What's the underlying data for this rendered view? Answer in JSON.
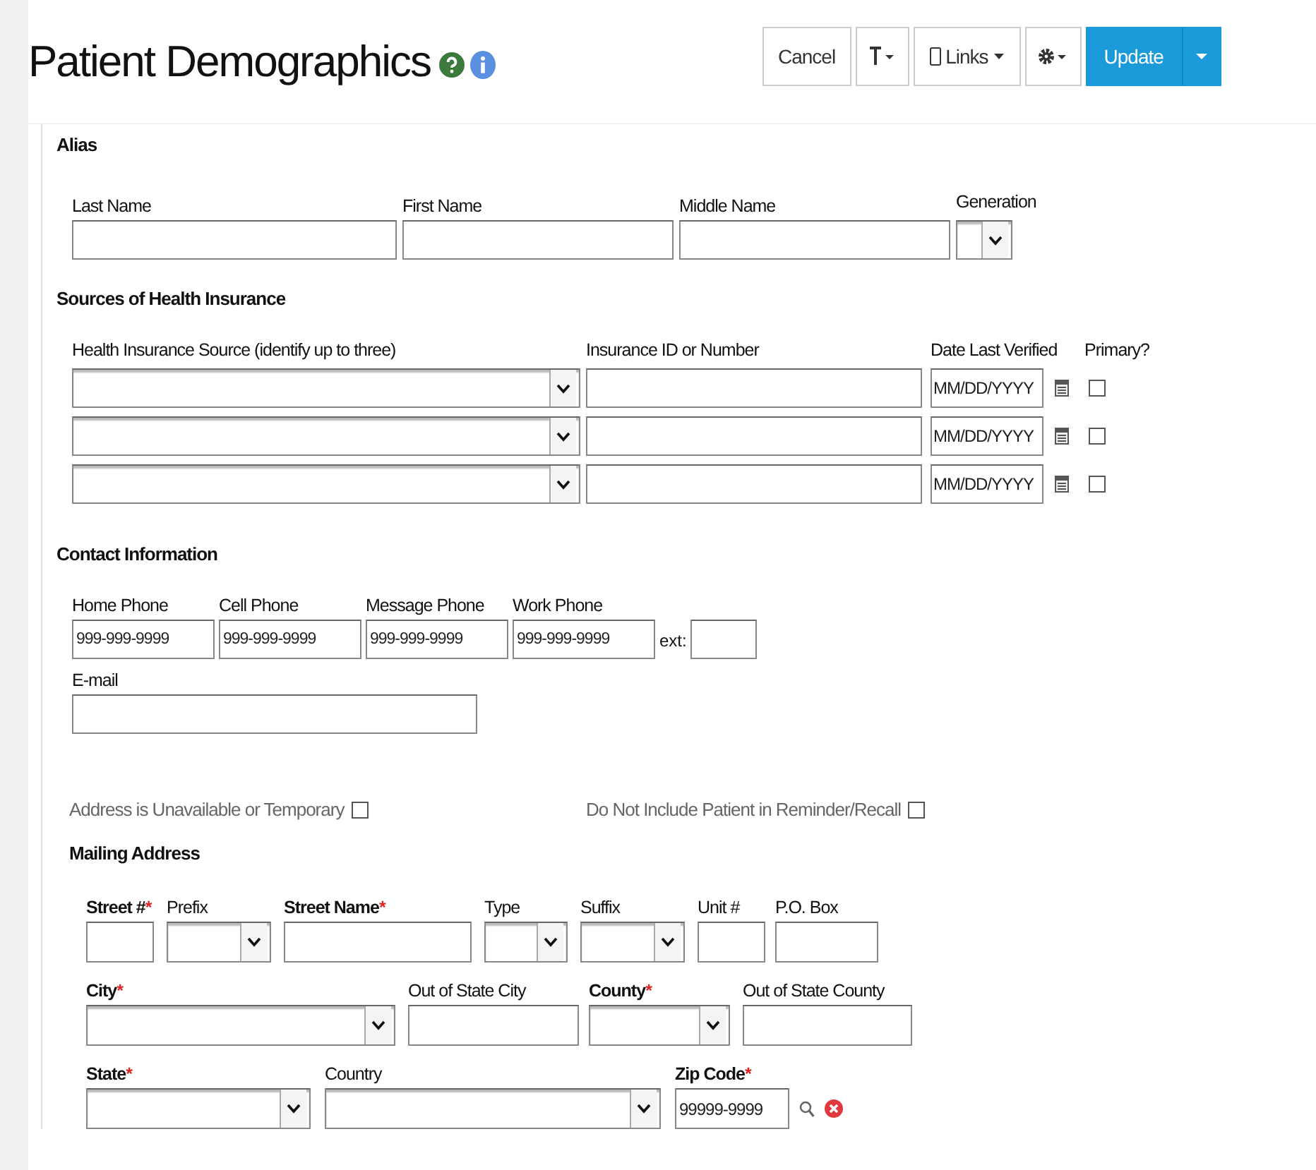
{
  "title": "Patient Demographics",
  "toolbar": [
    {
      "kind": "text",
      "label": "Cancel"
    },
    {
      "kind": "tool-menu"
    },
    {
      "kind": "links",
      "label": "Links"
    },
    {
      "kind": "settings-menu"
    },
    {
      "kind": "primary",
      "label": "Update"
    },
    {
      "kind": "split-caret"
    }
  ],
  "alias": {
    "heading": "Alias",
    "fields": [
      {
        "label": "Last Name",
        "kind": "text"
      },
      {
        "label": "First Name",
        "kind": "text"
      },
      {
        "label": "Middle Name",
        "kind": "text"
      },
      {
        "label": "Generation",
        "kind": "select"
      }
    ]
  },
  "insurance": {
    "heading": "Sources of Health Insurance",
    "columns": [
      "Health Insurance Source (identify up to three)",
      "Insurance ID or Number",
      "Date Last Verified",
      "Primary?"
    ],
    "rows": [
      {
        "date_placeholder": "MM/DD/YYYY",
        "primary": false
      },
      {
        "date_placeholder": "MM/DD/YYYY",
        "primary": false
      },
      {
        "date_placeholder": "MM/DD/YYYY",
        "primary": false
      }
    ]
  },
  "contact": {
    "heading": "Contact Information",
    "phones": [
      {
        "label": "Home Phone",
        "placeholder": "999-999-9999"
      },
      {
        "label": "Cell Phone",
        "placeholder": "999-999-9999"
      },
      {
        "label": "Message Phone",
        "placeholder": "999-999-9999"
      },
      {
        "label": "Work Phone",
        "placeholder": "999-999-9999"
      }
    ],
    "ext_label": "ext:",
    "email_label": "E-mail"
  },
  "options": [
    {
      "label": "Address is Unavailable or Temporary",
      "checked": false
    },
    {
      "label": "Do Not Include Patient in Reminder/Recall",
      "checked": false
    }
  ],
  "mailing": {
    "heading": "Mailing Address",
    "lines": [
      {
        "fields": [
          {
            "label": "Street #",
            "required_mark": "*",
            "kind": "text"
          },
          {
            "label": "Prefix",
            "kind": "select"
          },
          {
            "label": "Street Name",
            "required_mark": "*",
            "kind": "text"
          },
          {
            "label": "Type",
            "kind": "select"
          },
          {
            "label": "Suffix",
            "kind": "select"
          },
          {
            "label": "Unit #",
            "kind": "text"
          },
          {
            "label": "P.O. Box",
            "kind": "text"
          }
        ]
      },
      {
        "fields": [
          {
            "label": "City",
            "required_mark": "*",
            "kind": "select"
          },
          {
            "label": "Out of State City",
            "kind": "text"
          },
          {
            "label": "County",
            "required_mark": "*",
            "kind": "select"
          },
          {
            "label": "Out of State County",
            "kind": "text"
          }
        ]
      },
      {
        "fields": [
          {
            "label": "State",
            "required_mark": "*",
            "kind": "select"
          },
          {
            "label": "Country",
            "kind": "select"
          },
          {
            "label": "Zip Code",
            "required_mark": "*",
            "kind": "zip",
            "placeholder": "99999-9999"
          }
        ]
      }
    ]
  }
}
